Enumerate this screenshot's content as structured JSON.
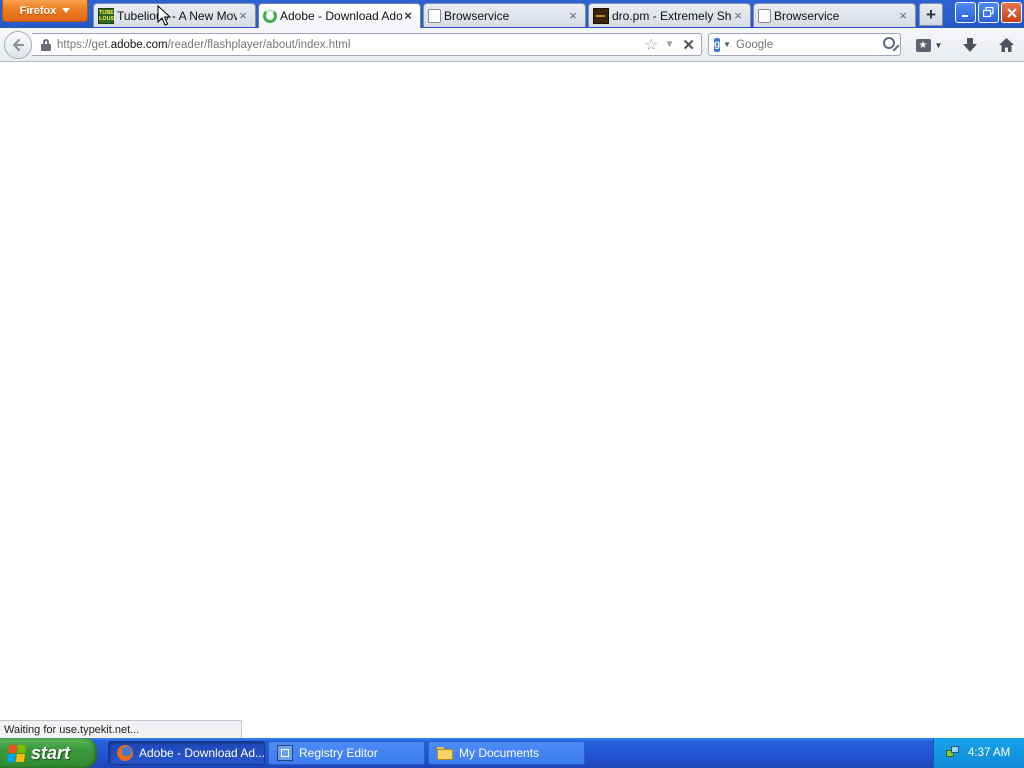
{
  "browser": {
    "menu_button_label": "Firefox",
    "tabs": [
      {
        "label": "Tubelious - A New Movie",
        "favicon": "tubelious-favicon",
        "active": false
      },
      {
        "label": "Adobe - Download Ado...",
        "favicon": "loading-spinner",
        "active": true
      },
      {
        "label": "Browservice",
        "favicon": "blank-page",
        "active": false
      },
      {
        "label": "dro.pm - Extremely Sho...",
        "favicon": "dro-pm-favicon",
        "active": false
      },
      {
        "label": "Browservice",
        "favicon": "blank-page",
        "active": false
      }
    ],
    "tab_close_glyph": "×",
    "new_tab_glyph": "+"
  },
  "navigation": {
    "url_prefix": "https://get.",
    "url_domain": "adobe.com",
    "url_path": "/reader/flashplayer/about/index.html",
    "search_placeholder": "Google"
  },
  "status": {
    "text": "Waiting for use.typekit.net..."
  },
  "taskbar": {
    "start_label": "start",
    "tasks": [
      {
        "label": "Adobe - Download Ad...",
        "icon": "firefox-icon",
        "active": true
      },
      {
        "label": "Registry Editor",
        "icon": "registry-editor-icon",
        "active": false
      },
      {
        "label": "My Documents",
        "icon": "folder-icon",
        "active": false
      }
    ],
    "clock": "4:37 AM"
  },
  "colors": {
    "firefox_button": "#e8751e",
    "titlebar": "#2a5fcf",
    "taskbar": "#2253d1",
    "start_button": "#3c9b3c",
    "systray": "#0f8bd8",
    "loading_spinner": "#3fae4c"
  }
}
